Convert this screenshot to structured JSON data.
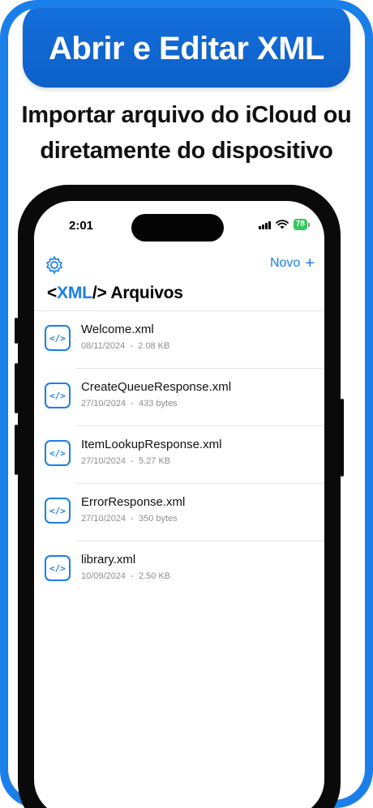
{
  "headline": "Abrir e Editar XML",
  "subtitle": {
    "line1": "Importar arquivo do iCloud ou",
    "line2": "diretamente do dispositivo"
  },
  "colors": {
    "accent": "#1a7fe8",
    "battery": "#34c759",
    "headline_bg": "#1570dc"
  },
  "status_bar": {
    "time": "2:01",
    "battery": "78"
  },
  "nav": {
    "settings_icon": "gear-icon",
    "new_label": "Novo",
    "new_icon": "plus-icon",
    "title_prefix": "<",
    "title_brand": "XML",
    "title_suffix": "/>",
    "title_rest": " Arquivos"
  },
  "files": [
    {
      "name": "Welcome.xml",
      "date": "08/11/2024",
      "size": "2.08 KB",
      "icon": "</>"
    },
    {
      "name": "CreateQueueResponse.xml",
      "date": "27/10/2024",
      "size": "433 bytes",
      "icon": "</>"
    },
    {
      "name": "ItemLookupResponse.xml",
      "date": "27/10/2024",
      "size": "5.27 KB",
      "icon": "</>"
    },
    {
      "name": "ErrorResponse.xml",
      "date": "27/10/2024",
      "size": "350 bytes",
      "icon": "</>"
    },
    {
      "name": "library.xml",
      "date": "10/09/2024",
      "size": "2.50 KB",
      "icon": "</>"
    }
  ],
  "meta_separator": "-"
}
